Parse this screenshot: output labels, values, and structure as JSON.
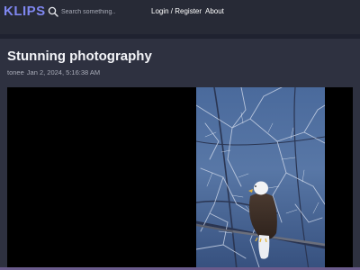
{
  "header": {
    "logo": "KLIPS",
    "search_placeholder": "Search something..",
    "search_value": "",
    "nav": {
      "login_label": "Login / Register",
      "about_label": "About"
    }
  },
  "post": {
    "title": "Stunning photography",
    "author": "tonee",
    "timestamp": "Jan 2, 2024, 5:16:38 AM"
  },
  "colors": {
    "accent": "#7f87f0",
    "background": "#2e3140",
    "navbar": "#272a36",
    "media_backdrop": "#000000"
  },
  "icons": {
    "search": "search-icon"
  }
}
